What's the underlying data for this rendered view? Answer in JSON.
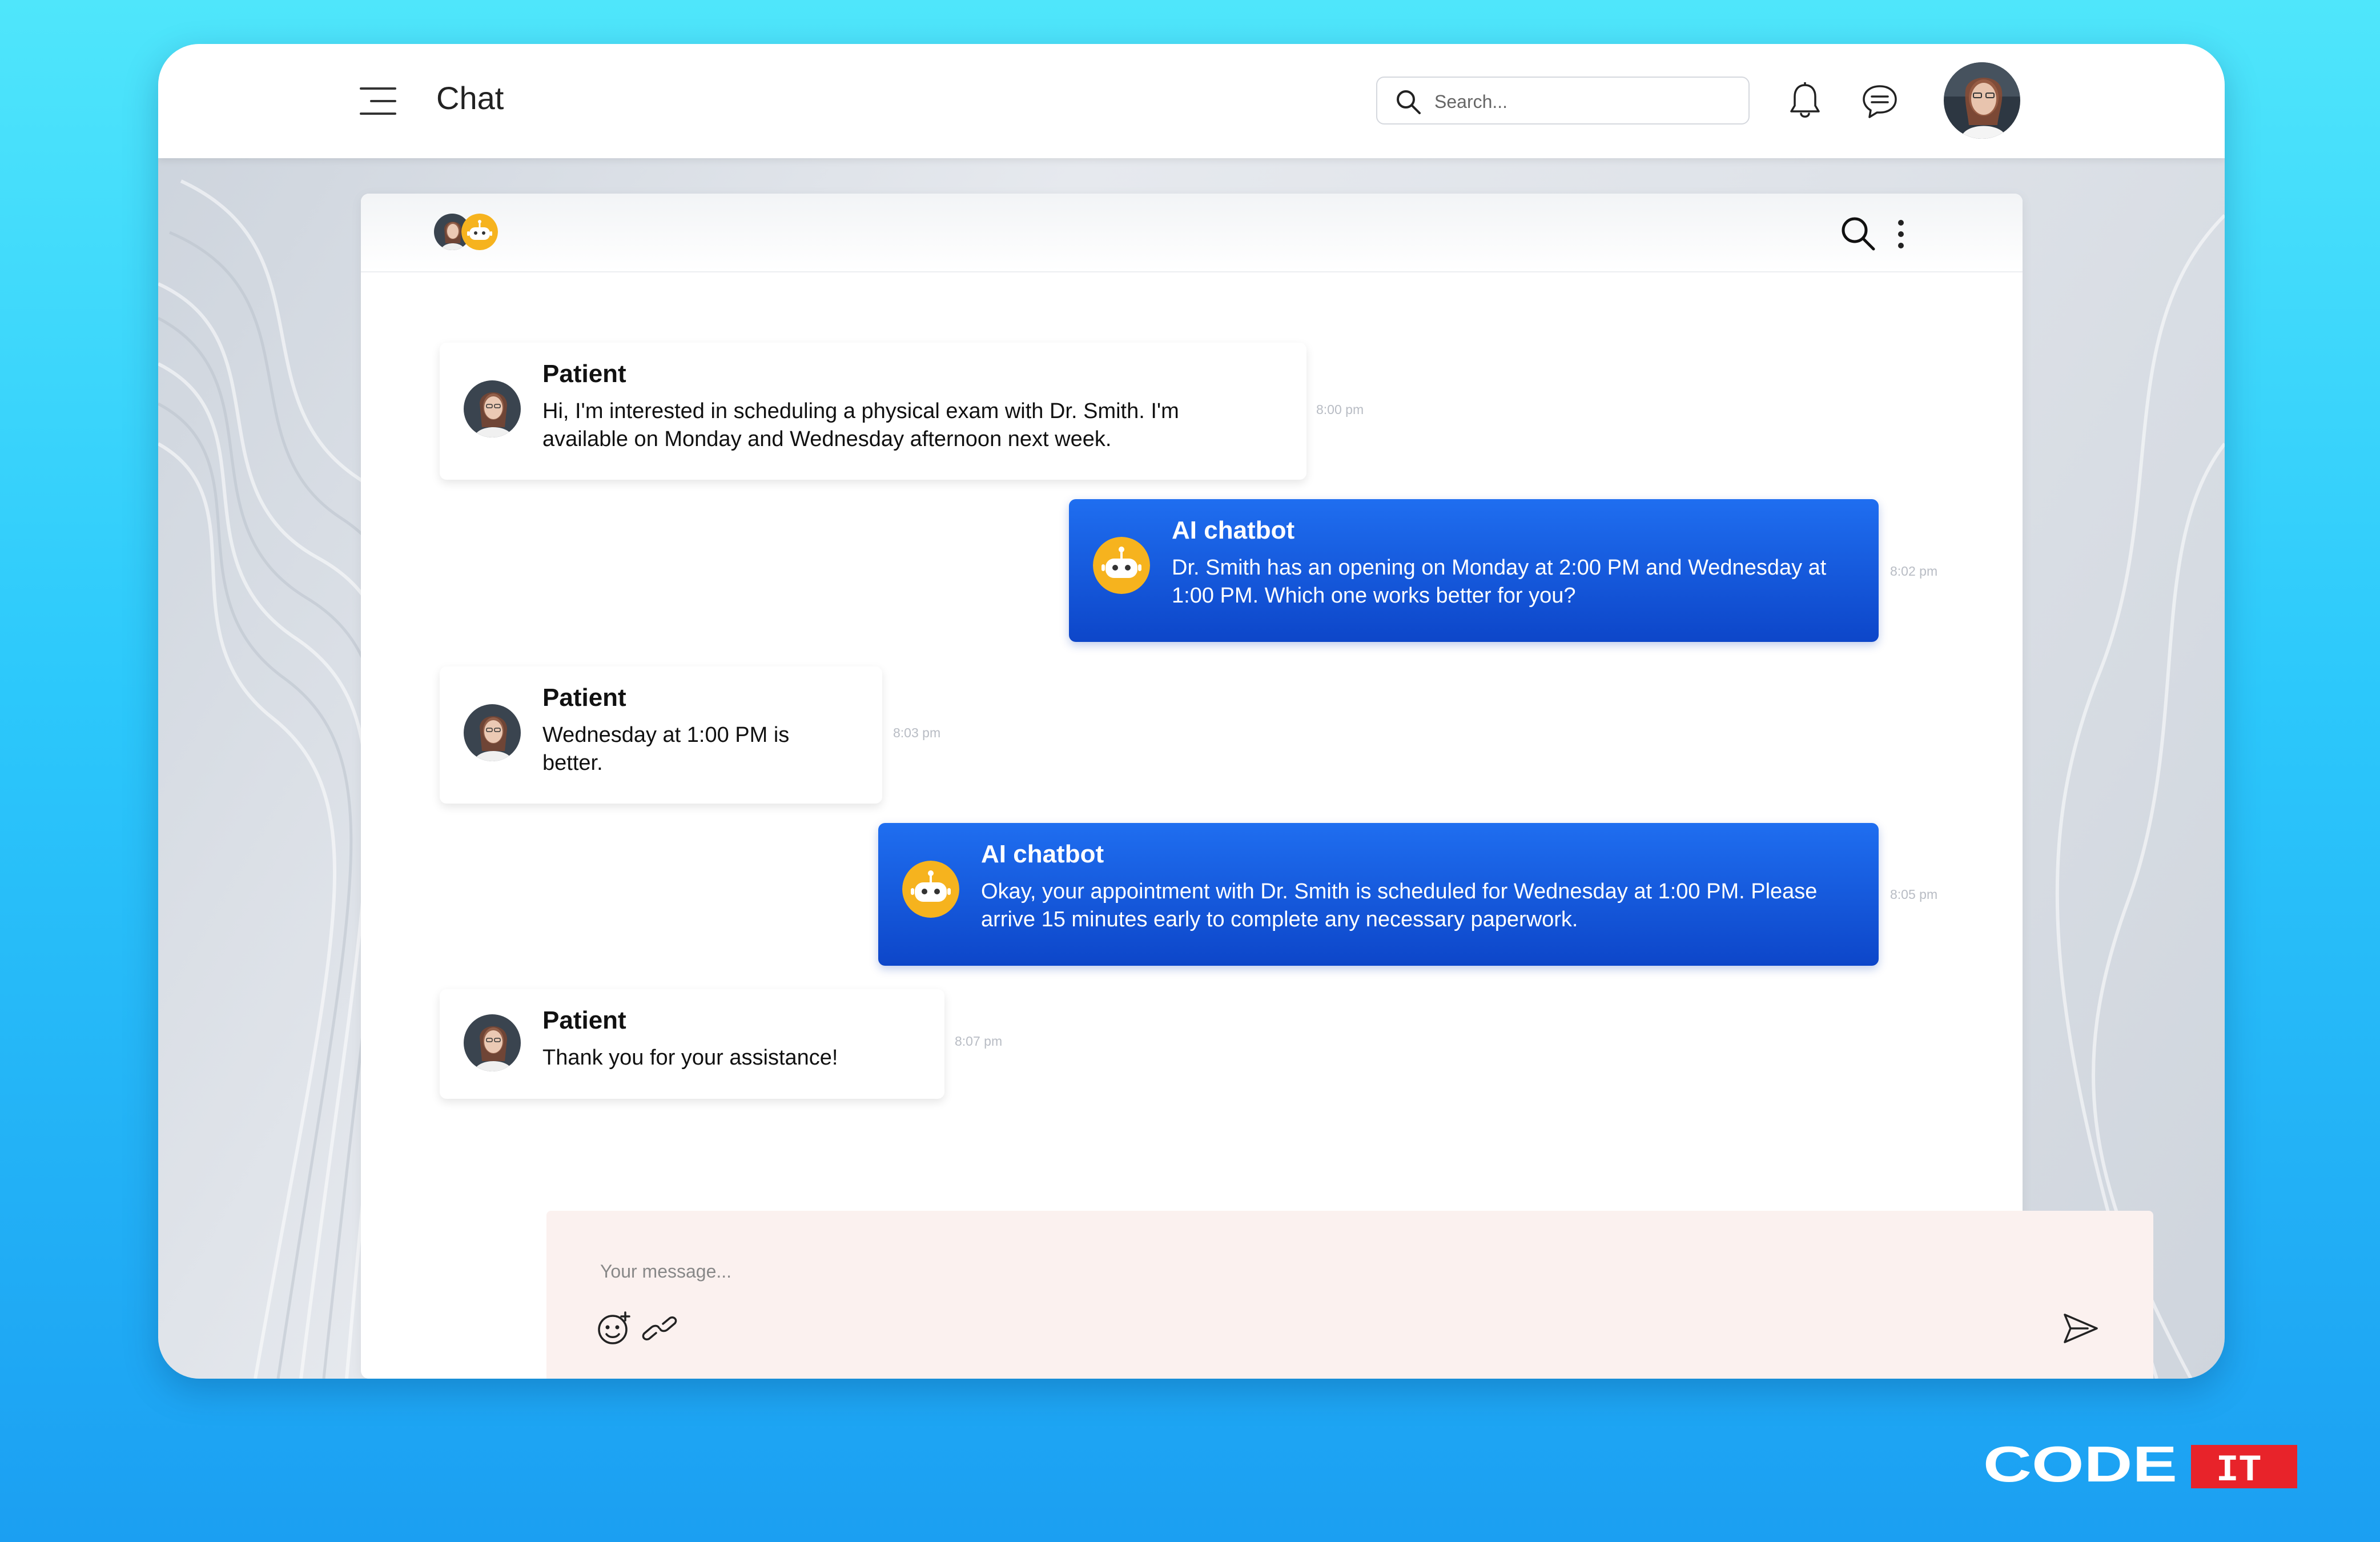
{
  "header": {
    "title": "Chat",
    "search_placeholder": "Search...",
    "icons": [
      "menu-icon",
      "search-icon",
      "bell-icon",
      "message-icon",
      "user-avatar"
    ]
  },
  "chat_header": {
    "participants": [
      "patient-avatar",
      "chatbot-avatar"
    ],
    "icons": [
      "search-icon",
      "more-vertical-icon"
    ]
  },
  "messages": [
    {
      "sender": "Patient",
      "text_line1": "Hi, I'm interested in scheduling a physical exam with Dr. Smith. I'm",
      "text_line2": "available on Monday and Wednesday afternoon next week.",
      "time": "8:00 pm"
    },
    {
      "sender": "AI chatbot",
      "text_line1": "Dr. Smith has an opening on Monday at 2:00 PM and Wednesday at",
      "text_line2": "1:00 PM. Which one works better for you?",
      "time": "8:02 pm"
    },
    {
      "sender": "Patient",
      "text_line1": "Wednesday at 1:00 PM is",
      "text_line2": "better.",
      "time": "8:03 pm"
    },
    {
      "sender": "AI chatbot",
      "text_line1": "Okay, your appointment with Dr. Smith is scheduled for Wednesday at 1:00 PM. Please",
      "text_line2": "arrive 15 minutes early to complete any necessary paperwork.",
      "time": "8:05 pm"
    },
    {
      "sender": "Patient",
      "text_line1": "Thank you for your assistance!",
      "text_line2": "",
      "time": "8:07 pm"
    }
  ],
  "composer": {
    "placeholder": "Your message...",
    "icons": [
      "emoji-icon",
      "link-icon",
      "send-icon"
    ]
  },
  "brand": {
    "logo_text_left": "CODE",
    "logo_text_right": "IT",
    "logo_accent": "#e8232a"
  },
  "colors": {
    "bot_bubble": "#1556db",
    "background": "#2cc8fb"
  }
}
